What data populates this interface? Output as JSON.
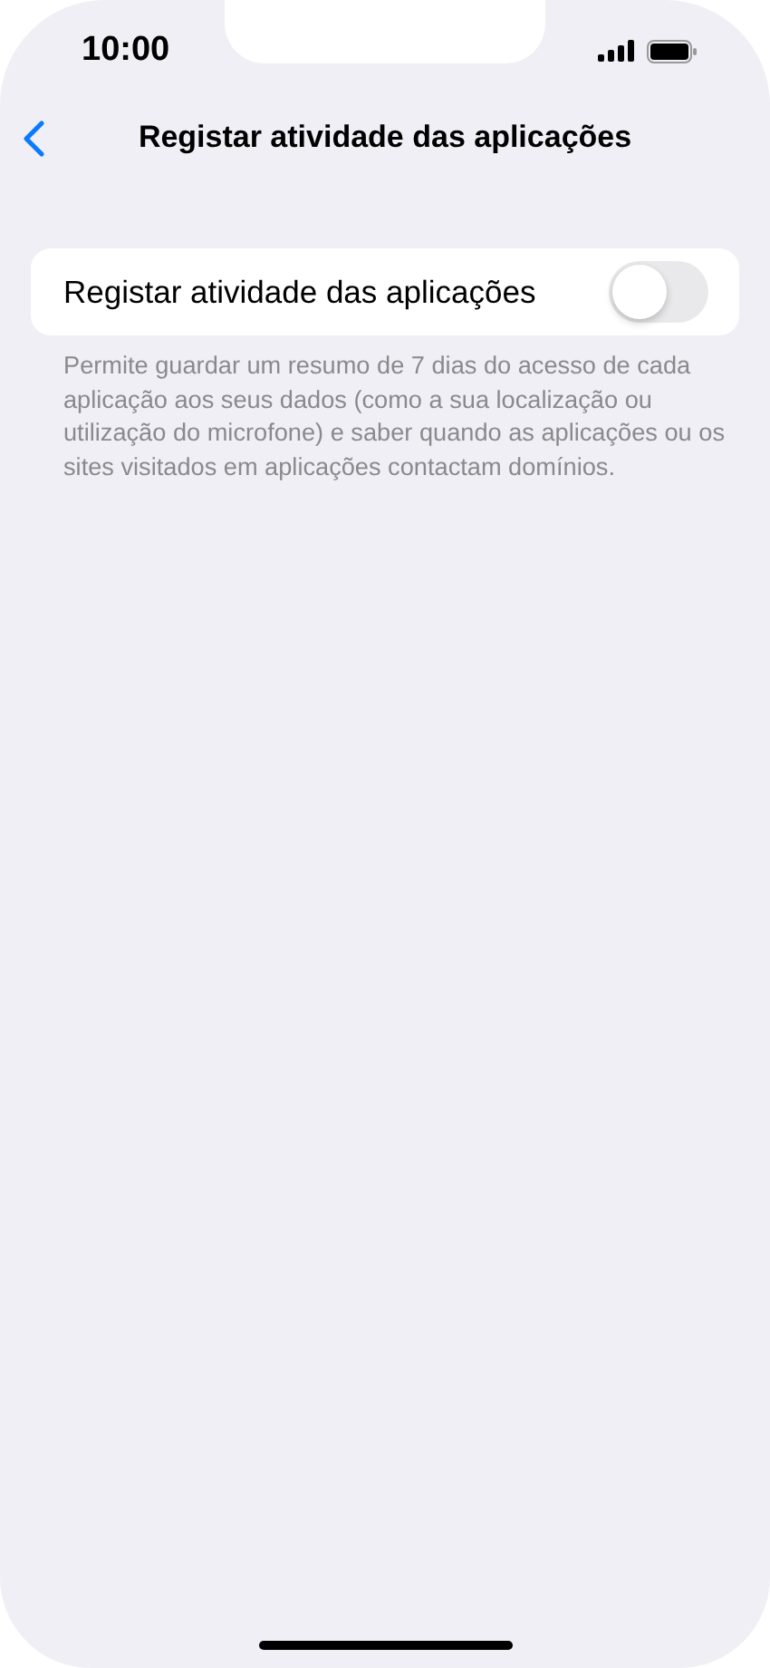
{
  "status_bar": {
    "time": "10:00"
  },
  "nav": {
    "title": "Registar atividade das aplicações"
  },
  "setting": {
    "label": "Registar atividade das aplicações",
    "on": false
  },
  "footer": "Permite guardar um resumo de 7 dias do acesso de cada aplicação aos seus dados (como a sua localização ou utilização do microfone) e saber quando as aplicações ou os sites visitados em aplicações contactam domínios."
}
